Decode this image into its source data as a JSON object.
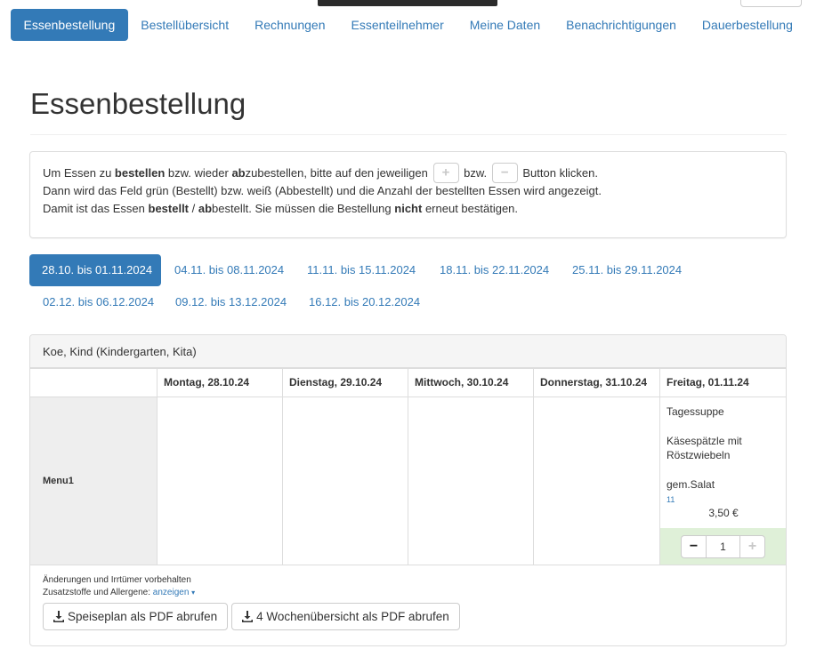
{
  "nav": {
    "items": [
      {
        "label": "Essenbestellung",
        "active": true
      },
      {
        "label": "Bestellübersicht",
        "active": false
      },
      {
        "label": "Rechnungen",
        "active": false
      },
      {
        "label": "Essenteilnehmer",
        "active": false
      },
      {
        "label": "Meine Daten",
        "active": false
      },
      {
        "label": "Benachrichtigungen",
        "active": false
      },
      {
        "label": "Dauerbestellung",
        "active": false
      }
    ]
  },
  "page": {
    "title": "Essenbestellung"
  },
  "info": {
    "line1_a": "Um Essen zu ",
    "line1_b": "bestellen",
    "line1_c": " bzw. wieder ",
    "line1_d": "ab",
    "line1_e": "zubestellen, bitte auf den jeweiligen",
    "line1_f": "bzw.",
    "line1_g": "Button klicken.",
    "plus_glyph": "+",
    "minus_glyph": "−",
    "line2": "Dann wird das Feld grün (Bestellt) bzw. weiß (Abbestellt) und die Anzahl der bestellten Essen wird angezeigt.",
    "line3_a": "Damit ist das Essen ",
    "line3_b": "bestellt",
    "line3_c": " / ",
    "line3_d": "ab",
    "line3_e": "bestellt. Sie müssen die Bestellung ",
    "line3_f": "nicht",
    "line3_g": " erneut bestätigen."
  },
  "weeks": [
    {
      "label": "28.10. bis 01.11.2024",
      "active": true
    },
    {
      "label": "04.11. bis 08.11.2024",
      "active": false
    },
    {
      "label": "11.11. bis 15.11.2024",
      "active": false
    },
    {
      "label": "18.11. bis 22.11.2024",
      "active": false
    },
    {
      "label": "25.11. bis 29.11.2024",
      "active": false
    },
    {
      "label": "02.12. bis 06.12.2024",
      "active": false
    },
    {
      "label": "09.12. bis 13.12.2024",
      "active": false
    },
    {
      "label": "16.12. bis 20.12.2024",
      "active": false
    }
  ],
  "panel": {
    "heading": "Koe, Kind (Kindergarten, Kita)",
    "days": [
      "Montag, 28.10.24",
      "Dienstag, 29.10.24",
      "Mittwoch, 30.10.24",
      "Donnerstag, 31.10.24",
      "Freitag, 01.11.24"
    ],
    "menu_label": "Menu1",
    "friday_dish": {
      "course1": "Tagessuppe",
      "course2": "Käsespätzle mit Röstzwiebeln",
      "course3": "gem.Salat",
      "allergen": "11",
      "price": "3,50 €",
      "quantity": "1",
      "minus_glyph": "−",
      "plus_glyph": "+",
      "ordered": true,
      "ordered_color": "#dff0d8"
    },
    "footer": {
      "disclaimer": "Änderungen und Irrtümer vorbehalten",
      "additives_label": "Zusatzstoffe und Allergene: ",
      "additives_link": "anzeigen",
      "caret": "▾",
      "btn_menu_pdf": "Speiseplan als PDF abrufen",
      "btn_4week_pdf": "4 Wochenübersicht als PDF abrufen",
      "download_icon": "download-icon"
    }
  },
  "colors": {
    "primary": "#337ab7",
    "ordered_green": "#dff0d8",
    "border": "#dddddd"
  }
}
